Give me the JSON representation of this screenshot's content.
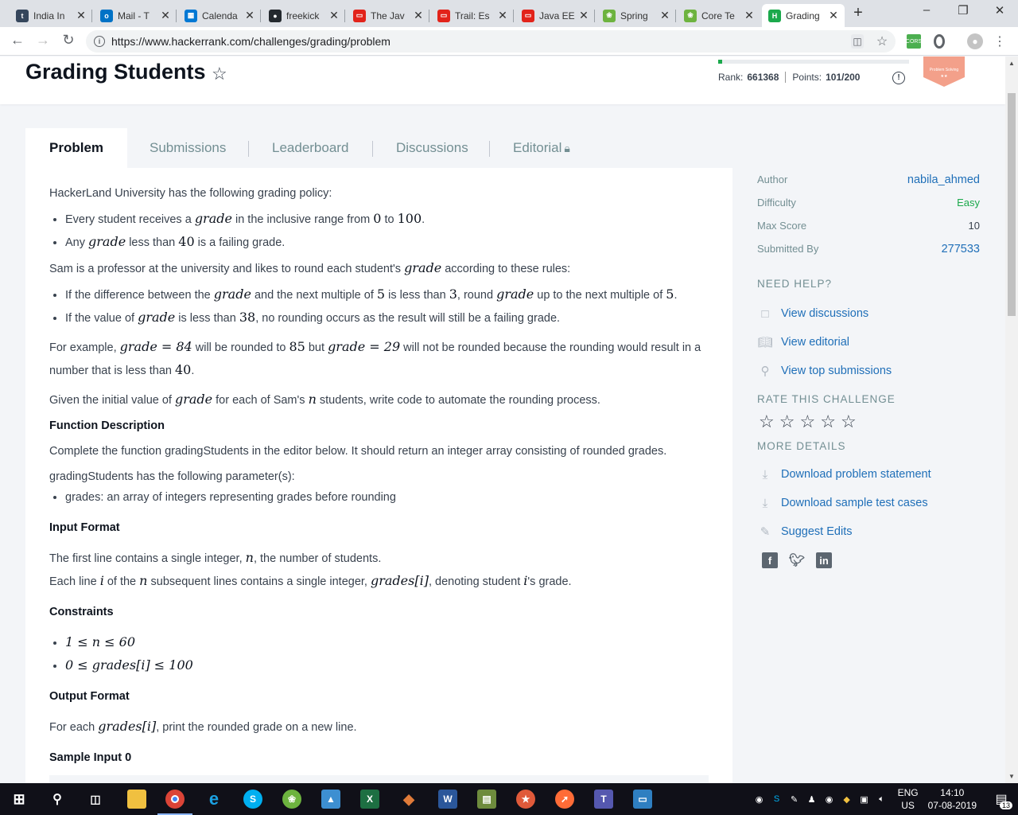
{
  "browser": {
    "tabs": [
      {
        "label": "India In",
        "icon": "tumblr-icon",
        "color": "#35465c",
        "glyph": "t"
      },
      {
        "label": "Mail - T",
        "icon": "outlook-icon",
        "color": "#0072c6",
        "glyph": "o"
      },
      {
        "label": "Calenda",
        "icon": "calendar-icon",
        "color": "#0078d4",
        "glyph": "▦"
      },
      {
        "label": "freekick",
        "icon": "github-icon",
        "color": "#24292e",
        "glyph": "●"
      },
      {
        "label": "The Jav",
        "icon": "oracle-icon",
        "color": "#e2231a",
        "glyph": "▭"
      },
      {
        "label": "Trail: Es",
        "icon": "oracle-icon",
        "color": "#e2231a",
        "glyph": "▭"
      },
      {
        "label": "Java EE",
        "icon": "oracle-icon",
        "color": "#e2231a",
        "glyph": "▭"
      },
      {
        "label": "Spring",
        "icon": "spring-icon",
        "color": "#6db33f",
        "glyph": "❀"
      },
      {
        "label": "Core Te",
        "icon": "spring-icon",
        "color": "#6db33f",
        "glyph": "❀"
      },
      {
        "label": "Grading",
        "icon": "hackerrank-icon",
        "color": "#1ba94c",
        "glyph": "H",
        "active": true
      }
    ],
    "url": "https://www.hackerrank.com/challenges/grading/problem"
  },
  "header": {
    "title": "Grading Students",
    "progress": 0.02,
    "rank_label": "Rank:",
    "rank_value": "661368",
    "points_label": "Points:",
    "points_value": "101/200",
    "badge_text": "Problem Solving",
    "badge_stars": "★★",
    "badge_color": "#f3a08a"
  },
  "tabs": {
    "problem": "Problem",
    "submissions": "Submissions",
    "leaderboard": "Leaderboard",
    "discussions": "Discussions",
    "editorial": "Editorial"
  },
  "problem": {
    "intro": "HackerLand University has the following grading policy:",
    "policy_1_a": "Every student receives a",
    "policy_1_b": "in the inclusive range from",
    "policy_1_c": "to",
    "policy_2_a": "Any",
    "policy_2_b": "less than",
    "policy_2_c": "is a failing grade.",
    "sam_a": "Sam is a professor at the university and likes to round each student's",
    "sam_b": "according to these rules:",
    "rule_1_a": "If the difference between the",
    "rule_1_b": "and the next multiple of",
    "rule_1_c": "is less than",
    "rule_1_d": ", round",
    "rule_1_e": "up to the next multiple of",
    "rule_2_a": "If the value of",
    "rule_2_b": "is less than",
    "rule_2_c": ", no rounding occurs as the result will still be a failing grade.",
    "example_a": "For example,",
    "example_b": "will be rounded to",
    "example_c": "but",
    "example_d": "will not be rounded because the rounding would result in a number that is less than",
    "given_a": "Given the initial value of",
    "given_b": "for each of Sam's",
    "given_c": "students, write code to automate the rounding process.",
    "func_desc_heading": "Function Description",
    "func_desc": "Complete the function gradingStudents in the editor below. It should return an integer array consisting of rounded grades.",
    "params_intro": "gradingStudents has the following parameter(s):",
    "param_1": "grades: an array of integers representing grades before rounding",
    "input_heading": "Input Format",
    "input_1_a": "The first line contains a single integer,",
    "input_1_b": ", the number of students.",
    "input_2_a": "Each line",
    "input_2_b": "of the",
    "input_2_c": "subsequent lines contains a single integer,",
    "input_2_d": ", denoting student",
    "input_2_e": "'s grade.",
    "constraints_heading": "Constraints",
    "output_heading": "Output Format",
    "output_a": "For each",
    "output_b": ", print the rounded grade on a new line.",
    "sample_heading": "Sample Input 0",
    "math": {
      "grade": "grade",
      "zero": "0",
      "hundred": "100",
      "forty": "40",
      "five": "5",
      "three": "3",
      "thirtyeight": "38",
      "grade84": "grade = 84",
      "eightyfive": "85",
      "grade29": "grade = 29",
      "n": "n",
      "i": "i",
      "grades_i": "grades[i]",
      "c1": "1 ≤ n ≤ 60",
      "c2": "0 ≤ grades[i] ≤ 100"
    }
  },
  "sidebar": {
    "author_label": "Author",
    "author": "nabila_ahmed",
    "difficulty_label": "Difficulty",
    "difficulty": "Easy",
    "maxscore_label": "Max Score",
    "maxscore": "10",
    "submitted_label": "Submitted By",
    "submitted": "277533",
    "need_help": "NEED HELP?",
    "view_discussions": "View discussions",
    "view_editorial": "View editorial",
    "view_top": "View top submissions",
    "rate": "RATE THIS CHALLENGE",
    "more": "MORE DETAILS",
    "download_statement": "Download problem statement",
    "download_tests": "Download sample test cases",
    "suggest": "Suggest Edits"
  },
  "taskbar": {
    "lang_top": "ENG",
    "lang_bottom": "US",
    "time": "14:10",
    "date": "07-08-2019",
    "notifications": "13"
  }
}
